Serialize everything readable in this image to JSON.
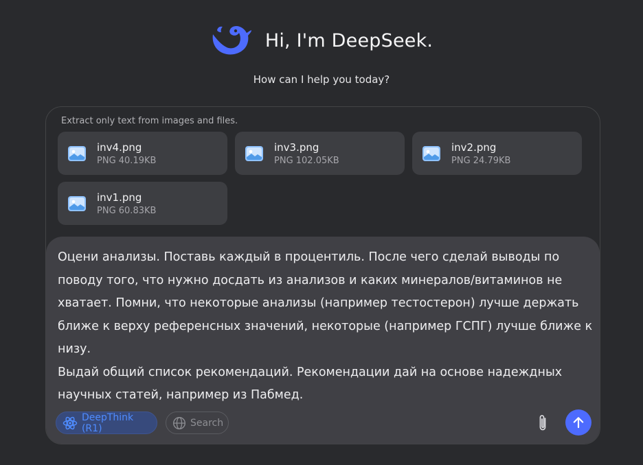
{
  "header": {
    "title": "Hi, I'm DeepSeek.",
    "subtitle": "How can I help you today?",
    "logo_icon": "deepseek-whale-logo",
    "brand_color": "#4d6bfe"
  },
  "composer": {
    "hint": "Extract only text from images and files.",
    "files": [
      {
        "name": "inv4.png",
        "size": "PNG 40.19KB",
        "icon": "image-file-icon"
      },
      {
        "name": "inv3.png",
        "size": "PNG 102.05KB",
        "icon": "image-file-icon"
      },
      {
        "name": "inv2.png",
        "size": "PNG 24.79KB",
        "icon": "image-file-icon"
      },
      {
        "name": "inv1.png",
        "size": "PNG 60.83KB",
        "icon": "image-file-icon"
      }
    ],
    "prompt": "Оцени анализы. Поставь каждый в процентиль. После чего сделай выводы по поводу того, что нужно досдать из анализов и каких минералов/витаминов не хватает. Помни, что некоторые анализы (например тестостерон) лучше держать ближе к верху референсных значений, некоторые (например ГСПГ) лучше ближе к низу.\nВыдай общий список рекомендаций. Рекомендации дай на основе надеждных научных статей, например из Пабмед.",
    "deepthink_label": "DeepThink (R1)",
    "deepthink_active": true,
    "search_label": "Search",
    "search_active": false,
    "attach_icon": "paperclip-icon",
    "send_icon": "arrow-up-icon"
  }
}
